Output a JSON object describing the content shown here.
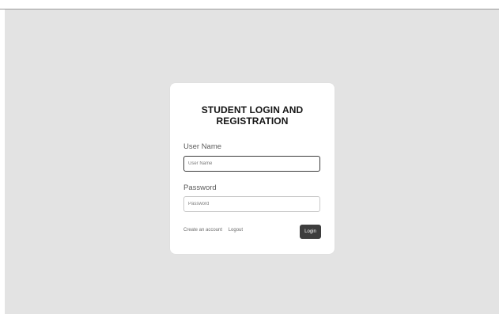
{
  "login_card": {
    "title_line1": "STUDENT LOGIN AND",
    "title_line2": "REGISTRATION",
    "username": {
      "label": "User Name",
      "placeholder": "User Name",
      "value": ""
    },
    "password": {
      "label": "Password",
      "placeholder": "Password",
      "value": ""
    },
    "create_account_link": "Create an account",
    "logout_link": "Logout",
    "login_button": "Login"
  },
  "colors": {
    "page_background": "#e3e3e3",
    "card_background": "#ffffff",
    "button_background": "#3d3d3d",
    "focused_input_border": "#3b3b3b",
    "input_border": "#c9c9c9"
  }
}
